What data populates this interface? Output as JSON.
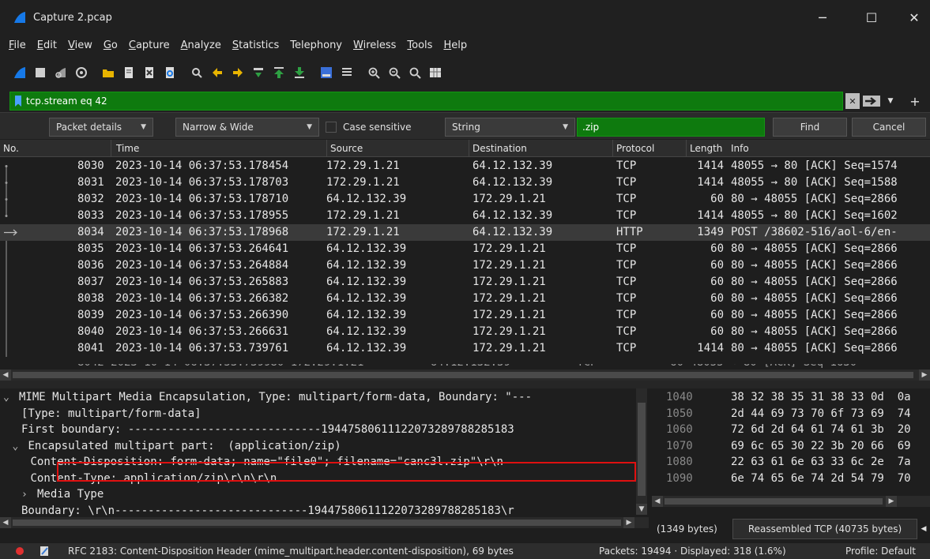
{
  "window": {
    "title": "Capture 2.pcap",
    "minimize": "─",
    "maximize": "☐",
    "close": "✕"
  },
  "menu": [
    {
      "u": "F",
      "rest": "ile"
    },
    {
      "u": "E",
      "rest": "dit"
    },
    {
      "u": "V",
      "rest": "iew"
    },
    {
      "u": "G",
      "rest": "o"
    },
    {
      "u": "C",
      "rest": "apture"
    },
    {
      "u": "A",
      "rest": "nalyze"
    },
    {
      "u": "S",
      "rest": "tatistics"
    },
    {
      "u": "",
      "rest": "Telephony"
    },
    {
      "u": "W",
      "rest": "ireless"
    },
    {
      "u": "T",
      "rest": "ools"
    },
    {
      "u": "H",
      "rest": "elp"
    }
  ],
  "toolbar_icons": [
    "start-capture-icon",
    "stop-capture-icon",
    "restart-capture-icon",
    "capture-options-icon",
    "open-file-icon",
    "save-file-icon",
    "close-file-icon",
    "reload-file-icon",
    "find-packet-icon",
    "go-back-icon",
    "go-forward-icon",
    "go-to-packet-icon",
    "go-first-icon",
    "go-last-icon",
    "autoscroll-icon",
    "colorize-icon",
    "zoom-in-icon",
    "zoom-out-icon",
    "zoom-normal-icon",
    "resize-columns-icon"
  ],
  "filter": {
    "value": "tcp.stream eq 42",
    "plus": "+"
  },
  "find": {
    "search_in": "Packet details",
    "char_width": "Narrow & Wide",
    "case_sensitive": "Case sensitive",
    "search_type": "String",
    "search_value": ".zip",
    "find_label": "Find",
    "cancel_label": "Cancel"
  },
  "columns": {
    "no": "No.",
    "time": "Time",
    "source": "Source",
    "destination": "Destination",
    "protocol": "Protocol",
    "length": "Length",
    "info": "Info"
  },
  "packets": [
    {
      "no": "8030",
      "time": "2023-10-14 06:37:53.178454",
      "src": "172.29.1.21",
      "dst": "64.12.132.39",
      "proto": "TCP",
      "len": "1414",
      "info": "48055 → 80 [ACK] Seq=1574"
    },
    {
      "no": "8031",
      "time": "2023-10-14 06:37:53.178703",
      "src": "172.29.1.21",
      "dst": "64.12.132.39",
      "proto": "TCP",
      "len": "1414",
      "info": "48055 → 80 [ACK] Seq=1588"
    },
    {
      "no": "8032",
      "time": "2023-10-14 06:37:53.178710",
      "src": "64.12.132.39",
      "dst": "172.29.1.21",
      "proto": "TCP",
      "len": "60",
      "info": "80 → 48055 [ACK] Seq=2866"
    },
    {
      "no": "8033",
      "time": "2023-10-14 06:37:53.178955",
      "src": "172.29.1.21",
      "dst": "64.12.132.39",
      "proto": "TCP",
      "len": "1414",
      "info": "48055 → 80 [ACK] Seq=1602"
    },
    {
      "no": "8034",
      "time": "2023-10-14 06:37:53.178968",
      "src": "172.29.1.21",
      "dst": "64.12.132.39",
      "proto": "HTTP",
      "len": "1349",
      "info": "POST /38602-516/aol-6/en-"
    },
    {
      "no": "8035",
      "time": "2023-10-14 06:37:53.264641",
      "src": "64.12.132.39",
      "dst": "172.29.1.21",
      "proto": "TCP",
      "len": "60",
      "info": "80 → 48055 [ACK] Seq=2866"
    },
    {
      "no": "8036",
      "time": "2023-10-14 06:37:53.264884",
      "src": "64.12.132.39",
      "dst": "172.29.1.21",
      "proto": "TCP",
      "len": "60",
      "info": "80 → 48055 [ACK] Seq=2866"
    },
    {
      "no": "8037",
      "time": "2023-10-14 06:37:53.265883",
      "src": "64.12.132.39",
      "dst": "172.29.1.21",
      "proto": "TCP",
      "len": "60",
      "info": "80 → 48055 [ACK] Seq=2866"
    },
    {
      "no": "8038",
      "time": "2023-10-14 06:37:53.266382",
      "src": "64.12.132.39",
      "dst": "172.29.1.21",
      "proto": "TCP",
      "len": "60",
      "info": "80 → 48055 [ACK] Seq=2866"
    },
    {
      "no": "8039",
      "time": "2023-10-14 06:37:53.266390",
      "src": "64.12.132.39",
      "dst": "172.29.1.21",
      "proto": "TCP",
      "len": "60",
      "info": "80 → 48055 [ACK] Seq=2866"
    },
    {
      "no": "8040",
      "time": "2023-10-14 06:37:53.266631",
      "src": "64.12.132.39",
      "dst": "172.29.1.21",
      "proto": "TCP",
      "len": "60",
      "info": "80 → 48055 [ACK] Seq=2866"
    },
    {
      "no": "8041",
      "time": "2023-10-14 06:37:53.739761",
      "src": "64.12.132.39",
      "dst": "172.29.1.21",
      "proto": "TCP",
      "len": "1414",
      "info": "80 → 48055 [ACK] Seq=2866"
    }
  ],
  "details": [
    {
      "indent": 0,
      "arrow": "⌄",
      "text": "MIME Multipart Media Encapsulation, Type: multipart/form-data, Boundary: \"---"
    },
    {
      "indent": 2,
      "arrow": "",
      "text": "[Type: multipart/form-data]"
    },
    {
      "indent": 2,
      "arrow": "",
      "text": "First boundary: -----------------------------19447580611122073289788285183"
    },
    {
      "indent": 1,
      "arrow": "⌄",
      "text": "Encapsulated multipart part:  (application/zip)"
    },
    {
      "indent": 3,
      "arrow": "",
      "text": "Content-Disposition: form-data; name=\"file0\"; filename=\"canc3l.zip\"\\r\\n"
    },
    {
      "indent": 3,
      "arrow": "",
      "text": "Content-Type: application/zip\\r\\n\\r\\n"
    },
    {
      "indent": 2,
      "arrow": "›",
      "text": "Media Type"
    },
    {
      "indent": 2,
      "arrow": "",
      "text": "Boundary: \\r\\n-----------------------------19447580611122073289788285183\\r"
    }
  ],
  "hex": [
    {
      "off": "1040",
      "bytes": "38 32 38 35 31 38 33 0d  0a"
    },
    {
      "off": "1050",
      "bytes": "2d 44 69 73 70 6f 73 69  74"
    },
    {
      "off": "1060",
      "bytes": "72 6d 2d 64 61 74 61 3b  20"
    },
    {
      "off": "1070",
      "bytes": "69 6c 65 30 22 3b 20 66  69"
    },
    {
      "off": "1080",
      "bytes": "22 63 61 6e 63 33 6c 2e  7a"
    },
    {
      "off": "1090",
      "bytes": "6e 74 65 6e 74 2d 54 79  70"
    }
  ],
  "hex_tabs": {
    "frame": "(1349 bytes)",
    "reassembled": "Reassembled TCP (40735 bytes)"
  },
  "status": {
    "field_info": "RFC 2183: Content-Disposition Header (mime_multipart.header.content-disposition), 69 bytes",
    "packets": "Packets: 19494 · Displayed: 318 (1.6%)",
    "profile": "Profile: Default"
  },
  "colors": {
    "filter_bg": "#0e7a0e",
    "highlight_box": "#e01010",
    "selected_row": "#3a3a3a"
  }
}
